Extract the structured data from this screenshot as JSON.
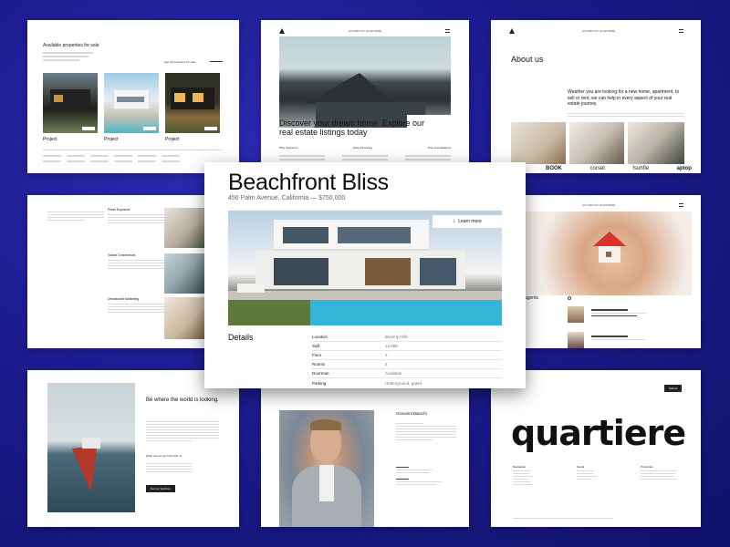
{
  "colors": {
    "background": "#1b1b8e",
    "card": "#ffffff",
    "text": "#111111",
    "pool": "#3fb8d4"
  },
  "card1": {
    "heading": "Available properties for sale",
    "link": "See all properties for sale",
    "project_1": "Project",
    "project_2": "Project",
    "project_3": "Project"
  },
  "card2": {
    "nav": "HOUSES   MY QUARTIERE",
    "headline": "Discover your dream home. Explore our real estate listings today",
    "features": [
      "Why choose us",
      "Easy Financing",
      "Free Consultations"
    ]
  },
  "card3": {
    "nav": "HOUSES   MY QUARTIERE",
    "title": "About us",
    "blurb": "Weather you are looking for a new home, apartment, to sell or rent, we can help in every aspect of your real estate journey.",
    "logos": [
      "BOOK",
      "corset",
      "fsuhfle",
      "aptop"
    ]
  },
  "card4": {
    "sections": [
      "Press Exposure",
      "Global Connections",
      "Unmatched Marketing"
    ]
  },
  "card6": {
    "nav": "HOUSES   MY QUARTIERE",
    "section": "de agents"
  },
  "card7": {
    "headline": "Be where the world is looking.",
    "subhead": "What can we get from/with us",
    "button": "Get our services"
  },
  "card8": {
    "name": "Giovanni Bianchi"
  },
  "card9": {
    "button": "Submit",
    "brand": "quartiere",
    "columns": [
      "Navigation",
      "Social",
      "Properties"
    ]
  },
  "featured": {
    "title": "Beachfront Bliss",
    "subtitle": "456 Palm Avenue, California — $750,000",
    "learn_more": "Learn more",
    "details_label": "Details",
    "rows": [
      {
        "label": "Location",
        "value": "Beverly Hills"
      },
      {
        "label": "Sqft",
        "value": "12,588"
      },
      {
        "label": "Floor",
        "value": "2"
      },
      {
        "label": "Rooms",
        "value": "4"
      },
      {
        "label": "Doorman",
        "value": "Available"
      },
      {
        "label": "Parking",
        "value": "Underground, gated"
      }
    ]
  }
}
